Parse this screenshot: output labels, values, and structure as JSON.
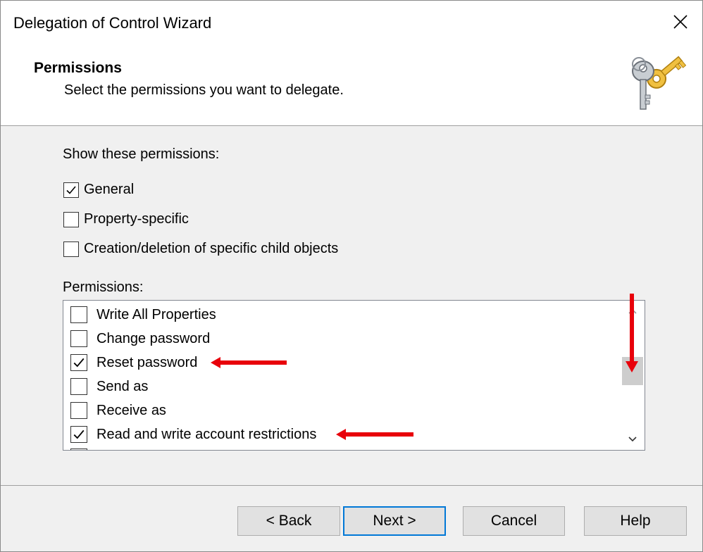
{
  "window": {
    "title": "Delegation of Control Wizard"
  },
  "header": {
    "title": "Permissions",
    "subtitle": "Select the permissions you want to delegate."
  },
  "show_permissions": {
    "label": "Show these permissions:",
    "options": [
      {
        "label": "General",
        "checked": true
      },
      {
        "label": "Property-specific",
        "checked": false
      },
      {
        "label": "Creation/deletion of specific child objects",
        "checked": false
      }
    ]
  },
  "permissions": {
    "label": "Permissions:",
    "items": [
      {
        "label": "Write All Properties",
        "checked": false
      },
      {
        "label": "Change password",
        "checked": false
      },
      {
        "label": "Reset password",
        "checked": true
      },
      {
        "label": "Send as",
        "checked": false
      },
      {
        "label": "Receive as",
        "checked": false
      },
      {
        "label": "Read and write account restrictions",
        "checked": true
      }
    ]
  },
  "buttons": {
    "back": "< Back",
    "next": "Next >",
    "cancel": "Cancel",
    "help": "Help"
  },
  "annotation_color": "#e8000b",
  "icons": {
    "close": "close-icon",
    "keys": "keys-icon",
    "check": "check-icon",
    "scroll_up": "chevron-up-icon",
    "scroll_down": "chevron-down-icon"
  }
}
